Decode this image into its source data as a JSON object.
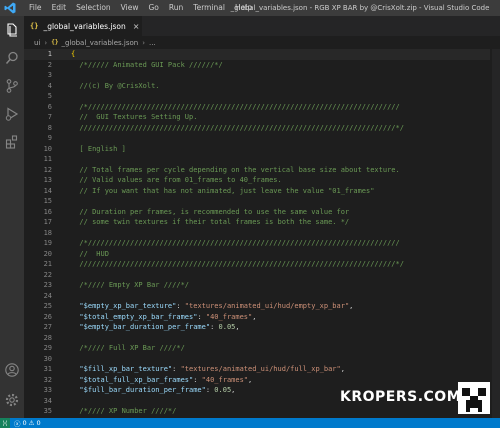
{
  "menu": [
    "File",
    "Edit",
    "Selection",
    "View",
    "Go",
    "Run",
    "Terminal",
    "Help"
  ],
  "window_title": "_global_variables.json - RGB XP BAR by @CrisXolt.zip - Visual Studio Code",
  "tab": {
    "icon": "{}",
    "label": "_global_variables.json",
    "close": "×"
  },
  "breadcrumb": {
    "root": "ui",
    "sep": "›",
    "icon": "{}",
    "file": "_global_variables.json",
    "tail": "..."
  },
  "status": {
    "remote": "⟩⟨",
    "errors": "0",
    "warnings": "0"
  },
  "watermark": {
    "text": "KROPERS.COM"
  },
  "editor": {
    "current_line": 1,
    "lines": [
      {
        "n": "1",
        "t": [
          {
            "c": "brace",
            "v": "{"
          }
        ]
      },
      {
        "n": "2",
        "t": [
          {
            "c": "comment",
            "v": "  /*///// Animated GUI Pack //////*/"
          }
        ]
      },
      {
        "n": "3",
        "t": []
      },
      {
        "n": "4",
        "t": [
          {
            "c": "comment",
            "v": "  //(c) By @CrisXolt."
          }
        ]
      },
      {
        "n": "5",
        "t": []
      },
      {
        "n": "6",
        "t": [
          {
            "c": "comment",
            "v": "  /*//////////////////////////////////////////////////////////////////////////"
          }
        ]
      },
      {
        "n": "7",
        "t": [
          {
            "c": "comment",
            "v": "  //  GUI Textures Setting Up."
          }
        ]
      },
      {
        "n": "8",
        "t": [
          {
            "c": "comment",
            "v": "  ///////////////////////////////////////////////////////////////////////////*/"
          }
        ]
      },
      {
        "n": "9",
        "t": []
      },
      {
        "n": "10",
        "t": [
          {
            "c": "comment",
            "v": "  [ English ]"
          }
        ]
      },
      {
        "n": "11",
        "t": []
      },
      {
        "n": "12",
        "t": [
          {
            "c": "comment",
            "v": "  // Total frames per cycle depending on the vertical base size about texture."
          }
        ]
      },
      {
        "n": "13",
        "t": [
          {
            "c": "comment",
            "v": "  // Valid values are from 01_frames to 40_frames."
          }
        ]
      },
      {
        "n": "14",
        "t": [
          {
            "c": "comment",
            "v": "  // If you want that has not animated, just leave the value \"01_frames\""
          }
        ]
      },
      {
        "n": "15",
        "t": []
      },
      {
        "n": "16",
        "t": [
          {
            "c": "comment",
            "v": "  // Duration per frames, is recommended to use the same value for"
          }
        ]
      },
      {
        "n": "17",
        "t": [
          {
            "c": "comment",
            "v": "  // some twin textures if their total frames is both the same. */"
          }
        ]
      },
      {
        "n": "18",
        "t": []
      },
      {
        "n": "19",
        "t": [
          {
            "c": "comment",
            "v": "  /*//////////////////////////////////////////////////////////////////////////"
          }
        ]
      },
      {
        "n": "20",
        "t": [
          {
            "c": "comment",
            "v": "  //  HUD"
          }
        ]
      },
      {
        "n": "21",
        "t": [
          {
            "c": "comment",
            "v": "  ///////////////////////////////////////////////////////////////////////////*/"
          }
        ]
      },
      {
        "n": "22",
        "t": []
      },
      {
        "n": "23",
        "t": [
          {
            "c": "comment",
            "v": "  /*//// Empty XP Bar ////*/"
          }
        ]
      },
      {
        "n": "24",
        "t": []
      },
      {
        "n": "25",
        "t": [
          {
            "c": "key",
            "v": "  \"$empty_xp_bar_texture\""
          },
          {
            "c": "punct",
            "v": ": "
          },
          {
            "c": "str",
            "v": "\"textures/animated_ui/hud/empty_xp_bar\""
          },
          {
            "c": "punct",
            "v": ","
          }
        ]
      },
      {
        "n": "26",
        "t": [
          {
            "c": "key",
            "v": "  \"$total_empty_xp_bar_frames\""
          },
          {
            "c": "punct",
            "v": ": "
          },
          {
            "c": "str",
            "v": "\"40_frames\""
          },
          {
            "c": "punct",
            "v": ","
          }
        ]
      },
      {
        "n": "27",
        "t": [
          {
            "c": "key",
            "v": "  \"$empty_bar_duration_per_frame\""
          },
          {
            "c": "punct",
            "v": ": "
          },
          {
            "c": "num",
            "v": "0.05"
          },
          {
            "c": "punct",
            "v": ","
          }
        ]
      },
      {
        "n": "28",
        "t": []
      },
      {
        "n": "29",
        "t": [
          {
            "c": "comment",
            "v": "  /*//// Full XP Bar ////*/"
          }
        ]
      },
      {
        "n": "30",
        "t": []
      },
      {
        "n": "31",
        "t": [
          {
            "c": "key",
            "v": "  \"$fill_xp_bar_texture\""
          },
          {
            "c": "punct",
            "v": ": "
          },
          {
            "c": "str",
            "v": "\"textures/animated_ui/hud/full_xp_bar\""
          },
          {
            "c": "punct",
            "v": ","
          }
        ]
      },
      {
        "n": "32",
        "t": [
          {
            "c": "key",
            "v": "  \"$total_full_xp_bar_frames\""
          },
          {
            "c": "punct",
            "v": ": "
          },
          {
            "c": "str",
            "v": "\"40_frames\""
          },
          {
            "c": "punct",
            "v": ","
          }
        ]
      },
      {
        "n": "33",
        "t": [
          {
            "c": "key",
            "v": "  \"$full_bar_duration_per_frame\""
          },
          {
            "c": "punct",
            "v": ": "
          },
          {
            "c": "num",
            "v": "0.05"
          },
          {
            "c": "punct",
            "v": ","
          }
        ]
      },
      {
        "n": "34",
        "t": []
      },
      {
        "n": "35",
        "t": [
          {
            "c": "comment",
            "v": "  /*//// XP Number ////*/"
          }
        ]
      }
    ]
  }
}
